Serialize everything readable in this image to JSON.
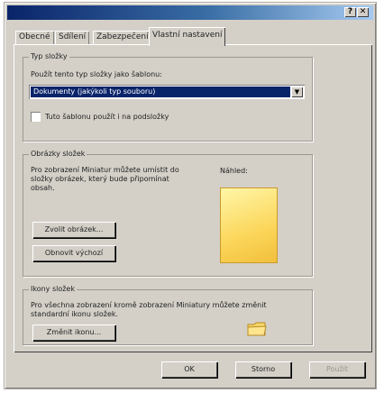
{
  "window": {
    "title": "",
    "help_glyph": "?",
    "close_glyph": "✕"
  },
  "tabs": [
    "Obecné",
    "Sdílení",
    "Zabezpečení",
    "Vlastní nastavení"
  ],
  "active_tab": 3,
  "folder_type": {
    "legend": "Typ složky",
    "prompt": "Použít tento typ složky jako šablonu:",
    "selected": "Dokumenty (jakýkoli typ souboru)",
    "checkbox_label": "Tuto šablonu použít i na podsložky",
    "checkbox_checked": false
  },
  "folder_pictures": {
    "legend": "Obrázky složek",
    "description": "Pro zobrazení Miniatur můžete umístit do složky obrázek, který bude připomínat obsah.",
    "preview_label": "Náhled:",
    "choose_button": "Zvolit obrázek...",
    "restore_button": "Obnovit výchozí"
  },
  "folder_icons": {
    "legend": "Ikony složek",
    "description": "Pro všechna zobrazení kromě zobrazení Miniatury můžete změnit standardní ikonu složek.",
    "change_button": "Změnit ikonu..."
  },
  "footer": {
    "ok": "OK",
    "cancel": "Storno",
    "apply": "Použít"
  },
  "colors": {
    "face": "#d4d0c8",
    "selection": "#0a246a",
    "folder": "#fbd65a"
  }
}
